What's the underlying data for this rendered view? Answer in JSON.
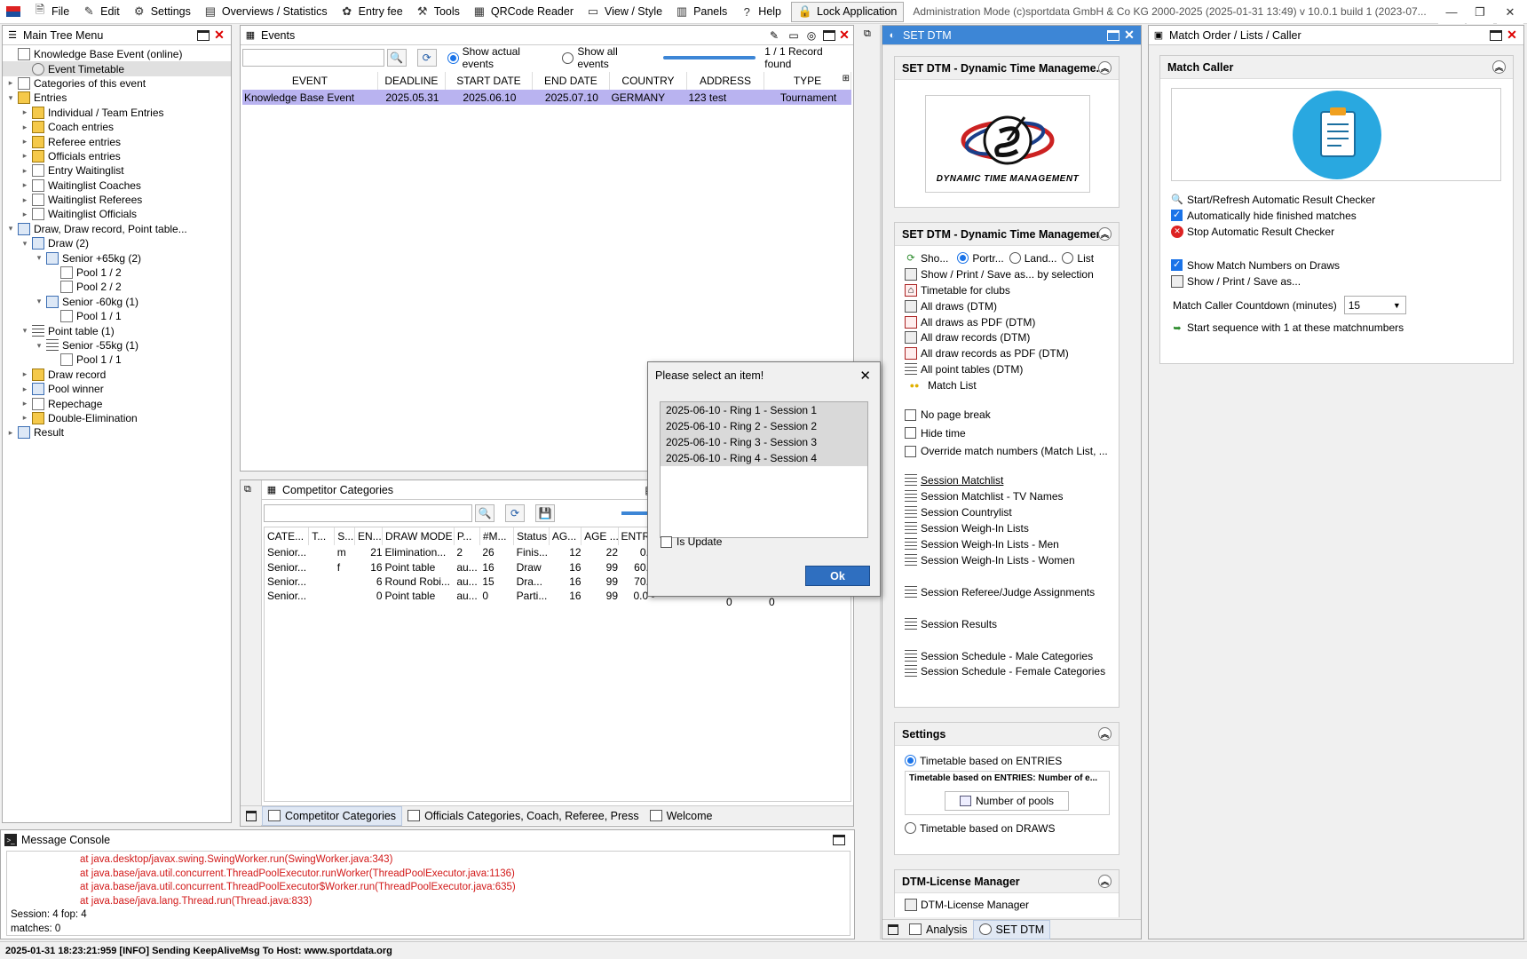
{
  "menubar": {
    "items": [
      {
        "label": "File",
        "icon": "file-icon"
      },
      {
        "label": "Edit",
        "icon": "edit-icon"
      },
      {
        "label": "Settings",
        "icon": "gear-icon"
      },
      {
        "label": "Overviews / Statistics",
        "icon": "statistics-icon"
      },
      {
        "label": "Entry fee",
        "icon": "money-icon"
      },
      {
        "label": "Tools",
        "icon": "tools-icon"
      },
      {
        "label": "QRCode Reader",
        "icon": "qrcode-icon"
      },
      {
        "label": "View / Style",
        "icon": "view-icon"
      },
      {
        "label": "Panels",
        "icon": "panels-icon"
      },
      {
        "label": "Help",
        "icon": "help-icon"
      }
    ],
    "lock_label": "Lock Application",
    "admin_text": "Administration Mode (c)sportdata GmbH & Co KG 2000-2025 (2025-01-31 13:49)  v 10.0.1 build 1 (2023-07..."
  },
  "main_tree": {
    "title": "Main Tree Menu",
    "nodes": [
      {
        "label": "Knowledge Base Event (online)",
        "level": 0,
        "twisty": "",
        "icon": "doc"
      },
      {
        "label": "Event Timetable",
        "level": 1,
        "twisty": "",
        "icon": "clock",
        "selected": true
      },
      {
        "label": "Categories of this event",
        "level": 0,
        "twisty": "▸",
        "icon": "doc"
      },
      {
        "label": "Entries",
        "level": 0,
        "twisty": "▾",
        "icon": "fold"
      },
      {
        "label": "Individual / Team Entries",
        "level": 1,
        "twisty": "▸",
        "icon": "fold"
      },
      {
        "label": "Coach entries",
        "level": 1,
        "twisty": "▸",
        "icon": "fold"
      },
      {
        "label": "Referee entries",
        "level": 1,
        "twisty": "▸",
        "icon": "fold"
      },
      {
        "label": "Officials entries",
        "level": 1,
        "twisty": "▸",
        "icon": "fold"
      },
      {
        "label": "Entry Waitinglist",
        "level": 1,
        "twisty": "▸",
        "icon": "doc"
      },
      {
        "label": "Waitinglist Coaches",
        "level": 1,
        "twisty": "▸",
        "icon": "doc"
      },
      {
        "label": "Waitinglist Referees",
        "level": 1,
        "twisty": "▸",
        "icon": "doc"
      },
      {
        "label": "Waitinglist Officials",
        "level": 1,
        "twisty": "▸",
        "icon": "doc"
      },
      {
        "label": "Draw, Draw record, Point table...",
        "level": 0,
        "twisty": "▾",
        "icon": "grid"
      },
      {
        "label": "Draw (2)",
        "level": 1,
        "twisty": "▾",
        "icon": "grid"
      },
      {
        "label": "Senior +65kg (2)",
        "level": 2,
        "twisty": "▾",
        "icon": "grid"
      },
      {
        "label": "Pool 1 / 2",
        "level": 3,
        "twisty": "",
        "icon": "doc"
      },
      {
        "label": "Pool 2 / 2",
        "level": 3,
        "twisty": "",
        "icon": "doc"
      },
      {
        "label": "Senior -60kg (1)",
        "level": 2,
        "twisty": "▾",
        "icon": "grid"
      },
      {
        "label": "Pool 1 / 1",
        "level": 3,
        "twisty": "",
        "icon": "doc"
      },
      {
        "label": "Point table (1)",
        "level": 1,
        "twisty": "▾",
        "icon": "list"
      },
      {
        "label": "Senior -55kg (1)",
        "level": 2,
        "twisty": "▾",
        "icon": "list"
      },
      {
        "label": "Pool 1 / 1",
        "level": 3,
        "twisty": "",
        "icon": "doc"
      },
      {
        "label": "Draw record",
        "level": 1,
        "twisty": "▸",
        "icon": "fold"
      },
      {
        "label": "Pool winner",
        "level": 1,
        "twisty": "▸",
        "icon": "grid"
      },
      {
        "label": "Repechage",
        "level": 1,
        "twisty": "▸",
        "icon": "doc"
      },
      {
        "label": "Double-Elimination",
        "level": 1,
        "twisty": "▸",
        "icon": "fold"
      },
      {
        "label": "Result",
        "level": 0,
        "twisty": "▸",
        "icon": "grid"
      }
    ]
  },
  "events": {
    "title": "Events",
    "search_value": "",
    "radio_actual": "Show actual events",
    "radio_all": "Show all events",
    "record_text": "1 / 1 Record found",
    "columns": [
      "EVENT",
      "DEADLINE",
      "START DATE",
      "END DATE",
      "COUNTRY",
      "ADDRESS",
      "TYPE"
    ],
    "rows": [
      [
        "Knowledge Base Event",
        "2025.05.31",
        "2025.06.10",
        "2025.07.10",
        "GERMANY",
        "123 test",
        "Tournament"
      ]
    ]
  },
  "categories": {
    "title": "Competitor Categories",
    "columns": [
      "CATE...",
      "T...",
      "S...",
      "EN...",
      "DRAW MODE",
      "P...",
      "#M...",
      "Status",
      "AG...",
      "AGE ...",
      "ENTR..."
    ],
    "rows": [
      [
        "Senior...",
        "",
        "m",
        "21",
        "Elimination...",
        "2",
        "26",
        "Finis...",
        "12",
        "22",
        "0.0"
      ],
      [
        "Senior...",
        "",
        "f",
        "16",
        "Point table",
        "au...",
        "16",
        "Draw",
        "16",
        "99",
        "60.0"
      ],
      [
        "Senior...",
        "",
        "",
        "6",
        "Round Robi...",
        "au...",
        "15",
        "Dra...",
        "16",
        "99",
        "70.0"
      ],
      [
        "Senior...",
        "",
        "",
        "0",
        "Point table",
        "au...",
        "0",
        "Parti...",
        "16",
        "99",
        "0.0 -"
      ]
    ],
    "extra": [
      "0",
      "0"
    ],
    "tabs": [
      "Competitor Categories",
      "Officials Categories, Coach, Referee, Press",
      "Welcome"
    ]
  },
  "console": {
    "title": "Message Console",
    "error_lines": [
      "at java.desktop/javax.swing.SwingWorker.run(SwingWorker.java:343)",
      "at java.base/java.util.concurrent.ThreadPoolExecutor.runWorker(ThreadPoolExecutor.java:1136)",
      "at java.base/java.util.concurrent.ThreadPoolExecutor$Worker.run(ThreadPoolExecutor.java:635)",
      "at java.base/java.lang.Thread.run(Thread.java:833)"
    ],
    "info_lines": [
      "Session: 4 fop: 4",
      "matches: 0"
    ]
  },
  "dialog": {
    "title": "Please select an item!",
    "items": [
      "2025-06-10 - Ring 1 - Session 1",
      "2025-06-10 - Ring 2 - Session 2",
      "2025-06-10 - Ring 3 - Session 3",
      "2025-06-10 - Ring 4 - Session 4"
    ],
    "checkbox": "Is Update",
    "ok": "Ok"
  },
  "dtm": {
    "title": "SET DTM",
    "sec1_title": "SET DTM - Dynamic Time Manageme...",
    "logo_text": "DYNAMIC TIME MANAGEMENT",
    "sec2_title": "SET DTM - Dynamic Time Management",
    "show_label": "Sho...",
    "portrait": "Portr...",
    "landscape": "Land...",
    "list": "List",
    "items": [
      {
        "label": "Show / Print / Save as... by selection",
        "icon": "print"
      },
      {
        "label": "Timetable for clubs",
        "icon": "home"
      },
      {
        "label": "All draws (DTM)",
        "icon": "print"
      },
      {
        "label": "All draws as PDF (DTM)",
        "icon": "pdf"
      },
      {
        "label": "All draw records (DTM)",
        "icon": "print"
      },
      {
        "label": "All draw records as PDF (DTM)",
        "icon": "pdf"
      },
      {
        "label": "All point tables (DTM)",
        "icon": "list"
      },
      {
        "label": "Match List",
        "icon": "people"
      }
    ],
    "checks": [
      "No page break",
      "Hide time",
      "Override match numbers (Match List, ..."
    ],
    "sessions1": [
      "Session Matchlist",
      "Session Matchlist - TV Names",
      "Session Countrylist",
      "Session Weigh-In Lists",
      "Session Weigh-In Lists - Men",
      "Session Weigh-In Lists - Women"
    ],
    "sessions2": [
      "Session Referee/Judge Assignments"
    ],
    "sessions3": [
      "Session Results"
    ],
    "sessions4": [
      "Session Schedule - Male Categories",
      "Session Schedule - Female Categories"
    ],
    "settings_title": "Settings",
    "radio_entries": "Timetable based on ENTRIES",
    "entries_group": "Timetable based on ENTRIES: Number of e...",
    "pools_btn": "Number of pools",
    "radio_draws": "Timetable based on DRAWS",
    "license_title": "DTM-License Manager",
    "license_item": "DTM-License Manager",
    "tabs": [
      "Analysis",
      "SET DTM"
    ]
  },
  "match_caller": {
    "title": "Match Order / Lists / Caller",
    "section": "Match Caller",
    "start": "Start/Refresh Automatic Result Checker",
    "auto_hide": "Automatically hide finished matches",
    "stop": "Stop Automatic Result Checker",
    "show_numbers": "Show Match Numbers on Draws",
    "show_print": "Show / Print / Save as...",
    "countdown_label": "Match Caller Countdown (minutes)",
    "countdown_value": "15",
    "sequence": "Start sequence with 1 at these matchnumbers"
  },
  "status_bar": "2025-01-31 18:23:21:959 [INFO] Sending KeepAliveMsg To Host: www.sportdata.org",
  "colors": {
    "accent": "#3d86d6",
    "error": "#d21919",
    "selection": "#b9b3f0"
  }
}
